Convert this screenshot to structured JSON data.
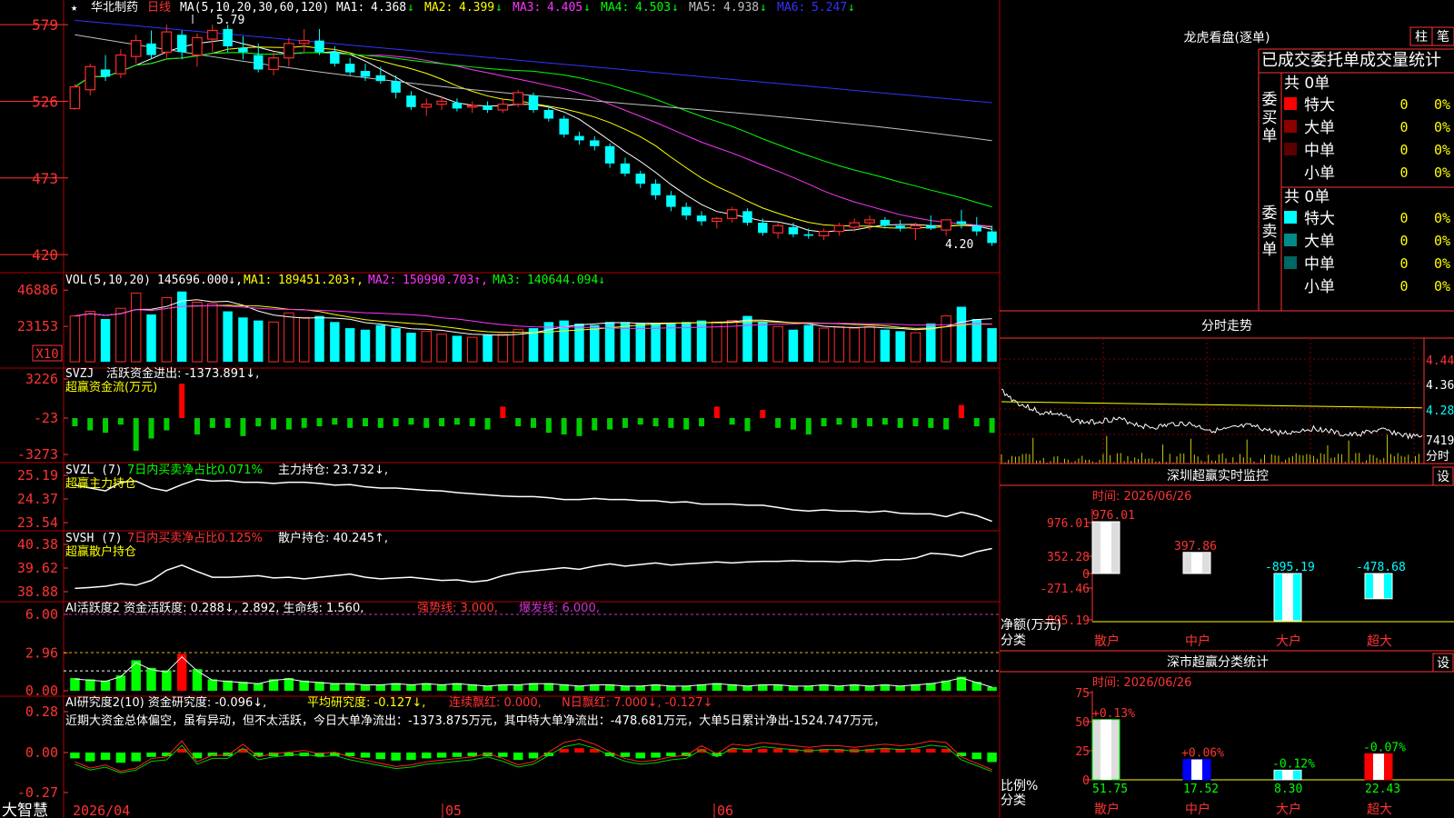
{
  "app": {
    "brand": "大智慧",
    "date_label": "2026/04",
    "month_labels": [
      "05",
      "06"
    ]
  },
  "colors": {
    "up": "#ff2a2a",
    "down": "#00ffff",
    "ma1": "#ffffff",
    "ma2": "#ffff00",
    "ma3": "#ff33ff",
    "ma4": "#00ff00",
    "ma5": "#c0c0c0",
    "ma6": "#3333ff",
    "grid": "#b00000",
    "axis": "#ff3333"
  },
  "price_panel": {
    "stock_name": "华北制药",
    "period": "日线",
    "indicator": "MA(5,10,20,30,60,120)",
    "ma": [
      {
        "label": "MA1:",
        "value": "4.368",
        "dir": "↓"
      },
      {
        "label": "MA2:",
        "value": "4.399",
        "dir": "↓"
      },
      {
        "label": "MA3:",
        "value": "4.405",
        "dir": "↓"
      },
      {
        "label": "MA4:",
        "value": "4.503",
        "dir": "↓"
      },
      {
        "label": "MA5:",
        "value": "4.938",
        "dir": "↓"
      },
      {
        "label": "MA6:",
        "value": "5.247",
        "dir": "↓"
      }
    ],
    "y_ticks": [
      "579",
      "526",
      "473",
      "420"
    ],
    "high_mark": "5.79",
    "low_mark": "4.20"
  },
  "vol_panel": {
    "indicator": "VOL(5,10,20)",
    "value": "145696.000↓,",
    "ma": [
      {
        "label": "MA1:",
        "value": "189451.203↑,"
      },
      {
        "label": "MA2:",
        "value": "150990.703↑,"
      },
      {
        "label": "MA3:",
        "value": "140644.094↓"
      }
    ],
    "y_ticks": [
      "46886",
      "23153"
    ],
    "unit": "X10"
  },
  "svzj_panel": {
    "name": "SVZJ",
    "text": "活跃资金进出: -1373.891↓,",
    "sub": "超赢资金流(万元)",
    "y_ticks": [
      "3226",
      "-23",
      "-3273"
    ]
  },
  "svzl_panel": {
    "name": "SVZL (7)",
    "text1": "7日内买卖净占比0.071%",
    "text2": "主力持仓: 23.732↓,",
    "sub": "超赢主力持仓",
    "y_ticks": [
      "25.19",
      "24.37",
      "23.54"
    ]
  },
  "svsh_panel": {
    "name": "SVSH (7)",
    "text1": "7日内买卖净占比0.125%",
    "text2": "散户持仓: 40.245↑,",
    "sub": "超赢散户持仓",
    "y_ticks": [
      "40.38",
      "39.62",
      "38.88"
    ]
  },
  "ai_panel": {
    "title": "AI活跃度2 资金活跃度: 0.288↓, 2.892, 生命线: 1.560,",
    "strong": "强势线: 3.000,",
    "burst": "爆发线: 6.000,",
    "y_ticks": [
      "6.00",
      "2.96",
      "0.00"
    ]
  },
  "ai2_panel": {
    "title": "AI研究度2(10) 资金研究度: -0.096↓,",
    "avg": "平均研究度: -0.127↓,",
    "red": "连续飘红: 0.000,",
    "nred": "N日飘红: 7.000↓, -0.127↓",
    "comment": "近期大资金总体偏空，虽有异动，但不太活跃，今日大单净流出：-1373.875万元，其中特大单净流出：-478.681万元，大单5日累计净出-1524.747万元，",
    "y_ticks": [
      "0.28",
      "0.00",
      "-0.27"
    ]
  },
  "right": {
    "title": "龙虎看盘(逐单)",
    "btn1": "柱",
    "btn2": "笔",
    "heading": "已成交委托单成交量统计",
    "buy_label": "委买单",
    "sell_label": "委卖单",
    "buy_total": "共 0单",
    "sell_total": "共 0单",
    "buy_rows": [
      {
        "name": "特大",
        "n": "0",
        "p": "0%",
        "c": "#ff0000"
      },
      {
        "name": "大单",
        "n": "0",
        "p": "0%",
        "c": "#8b0000"
      },
      {
        "name": "中单",
        "n": "0",
        "p": "0%",
        "c": "#5a0000"
      },
      {
        "name": "小单",
        "n": "0",
        "p": "0%",
        "c": "#000000"
      }
    ],
    "sell_rows": [
      {
        "name": "特大",
        "n": "0",
        "p": "0%",
        "c": "#00ffff"
      },
      {
        "name": "大单",
        "n": "0",
        "p": "0%",
        "c": "#008b8b"
      },
      {
        "name": "中单",
        "n": "0",
        "p": "0%",
        "c": "#006666"
      },
      {
        "name": "小单",
        "n": "0",
        "p": "0%",
        "c": "#000000"
      }
    ],
    "intraday_title": "分时走势",
    "intraday_ticks": [
      "4.440",
      "4.360",
      "4.280",
      "7419",
      "分时"
    ],
    "monitor_title": "深圳超赢实时监控",
    "monitor_time": "时间: 2026/06/26",
    "set": "设",
    "monitor_axis": [
      "976.01",
      "352.28",
      "0",
      "-271.46",
      "-895.19"
    ],
    "monitor_unit": "净额(万元)",
    "monitor_cat": "分类",
    "monitor_bars": [
      {
        "cat": "散户",
        "value": 976.01,
        "label": "976.01"
      },
      {
        "cat": "中户",
        "value": 397.86,
        "label": "397.86"
      },
      {
        "cat": "大户",
        "value": -895.19,
        "label": "-895.19"
      },
      {
        "cat": "超大",
        "value": -478.68,
        "label": "-478.68"
      }
    ],
    "stat_title": "深市超赢分类统计",
    "stat_time": "时间: 2026/06/26",
    "stat_axis": [
      "75",
      "50",
      "25",
      "0"
    ],
    "stat_unit": "比例%",
    "stat_cat": "分类",
    "stat_bars": [
      {
        "cat": "散户",
        "value": 51.75,
        "label": "51.75",
        "chg": "+0.13%"
      },
      {
        "cat": "中户",
        "value": 17.52,
        "label": "17.52",
        "chg": "+0.06%"
      },
      {
        "cat": "大户",
        "value": 8.3,
        "label": "8.30",
        "chg": "-0.12%"
      },
      {
        "cat": "超大",
        "value": 22.43,
        "label": "22.43",
        "chg": "-0.07%"
      }
    ]
  },
  "chart_data": {
    "type": "candlestick",
    "x": [
      "2026/04",
      "05",
      "06"
    ],
    "ohlc": [
      [
        5.21,
        5.38,
        5.2,
        5.36
      ],
      [
        5.34,
        5.52,
        5.3,
        5.5
      ],
      [
        5.48,
        5.58,
        5.4,
        5.43
      ],
      [
        5.45,
        5.62,
        5.42,
        5.58
      ],
      [
        5.57,
        5.72,
        5.52,
        5.68
      ],
      [
        5.66,
        5.75,
        5.55,
        5.58
      ],
      [
        5.6,
        5.79,
        5.56,
        5.74
      ],
      [
        5.72,
        5.75,
        5.55,
        5.6
      ],
      [
        5.58,
        5.73,
        5.5,
        5.7
      ],
      [
        5.69,
        5.79,
        5.6,
        5.75
      ],
      [
        5.76,
        5.79,
        5.6,
        5.64
      ],
      [
        5.63,
        5.71,
        5.55,
        5.6
      ],
      [
        5.58,
        5.66,
        5.46,
        5.48
      ],
      [
        5.48,
        5.6,
        5.44,
        5.56
      ],
      [
        5.56,
        5.7,
        5.5,
        5.66
      ],
      [
        5.66,
        5.76,
        5.6,
        5.68
      ],
      [
        5.68,
        5.76,
        5.58,
        5.6
      ],
      [
        5.6,
        5.64,
        5.5,
        5.52
      ],
      [
        5.52,
        5.56,
        5.44,
        5.46
      ],
      [
        5.47,
        5.52,
        5.4,
        5.43
      ],
      [
        5.44,
        5.5,
        5.38,
        5.4
      ],
      [
        5.4,
        5.44,
        5.28,
        5.32
      ],
      [
        5.3,
        5.33,
        5.2,
        5.22
      ],
      [
        5.22,
        5.28,
        5.16,
        5.24
      ],
      [
        5.24,
        5.3,
        5.2,
        5.26
      ],
      [
        5.25,
        5.28,
        5.19,
        5.21
      ],
      [
        5.22,
        5.26,
        5.18,
        5.23
      ],
      [
        5.23,
        5.26,
        5.18,
        5.2
      ],
      [
        5.2,
        5.27,
        5.18,
        5.24
      ],
      [
        5.24,
        5.34,
        5.22,
        5.32
      ],
      [
        5.3,
        5.32,
        5.18,
        5.2
      ],
      [
        5.2,
        5.23,
        5.12,
        5.14
      ],
      [
        5.14,
        5.16,
        5.01,
        5.03
      ],
      [
        5.02,
        5.05,
        4.96,
        4.99
      ],
      [
        4.99,
        5.02,
        4.92,
        4.95
      ],
      [
        4.95,
        4.97,
        4.8,
        4.83
      ],
      [
        4.83,
        4.87,
        4.74,
        4.76
      ],
      [
        4.76,
        4.78,
        4.66,
        4.69
      ],
      [
        4.69,
        4.72,
        4.58,
        4.61
      ],
      [
        4.61,
        4.64,
        4.5,
        4.53
      ],
      [
        4.53,
        4.56,
        4.44,
        4.47
      ],
      [
        4.47,
        4.5,
        4.4,
        4.43
      ],
      [
        4.43,
        4.46,
        4.38,
        4.45
      ],
      [
        4.45,
        4.53,
        4.42,
        4.51
      ],
      [
        4.5,
        4.52,
        4.4,
        4.42
      ],
      [
        4.42,
        4.45,
        4.33,
        4.35
      ],
      [
        4.35,
        4.42,
        4.31,
        4.4
      ],
      [
        4.39,
        4.42,
        4.32,
        4.34
      ],
      [
        4.34,
        4.38,
        4.31,
        4.33
      ],
      [
        4.33,
        4.38,
        4.3,
        4.36
      ],
      [
        4.36,
        4.42,
        4.33,
        4.4
      ],
      [
        4.39,
        4.45,
        4.36,
        4.42
      ],
      [
        4.42,
        4.47,
        4.37,
        4.44
      ],
      [
        4.44,
        4.46,
        4.38,
        4.4
      ],
      [
        4.4,
        4.44,
        4.36,
        4.38
      ],
      [
        4.38,
        4.42,
        4.3,
        4.4
      ],
      [
        4.4,
        4.47,
        4.37,
        4.38
      ],
      [
        4.37,
        4.43,
        4.33,
        4.44
      ],
      [
        4.43,
        4.51,
        4.38,
        4.41
      ],
      [
        4.4,
        4.46,
        4.33,
        4.36
      ],
      [
        4.36,
        4.4,
        4.26,
        4.28
      ]
    ],
    "volume": [
      30000,
      33000,
      28000,
      35000,
      45000,
      31000,
      42000,
      46000,
      39000,
      38000,
      33000,
      29000,
      27000,
      26000,
      32000,
      29000,
      30000,
      26000,
      22000,
      21000,
      24000,
      22000,
      19000,
      20000,
      18000,
      17000,
      16000,
      17500,
      18000,
      21000,
      22000,
      26000,
      27000,
      25000,
      24000,
      26000,
      26000,
      25000,
      25000,
      25000,
      26000,
      27000,
      26000,
      27000,
      30000,
      26000,
      23000,
      21000,
      24000,
      22000,
      23000,
      22000,
      23000,
      21000,
      20000,
      19000,
      25000,
      30000,
      36000,
      28000,
      22000
    ],
    "svzj": [
      -10,
      -15,
      -18,
      -8,
      -40,
      -25,
      -15,
      42,
      -20,
      -12,
      -12,
      -22,
      -10,
      -14,
      -14,
      -12,
      -10,
      -8,
      -12,
      -10,
      -12,
      -10,
      -8,
      -12,
      -10,
      -8,
      -10,
      -14,
      14,
      -10,
      -12,
      -18,
      -20,
      -22,
      -15,
      -14,
      -12,
      -8,
      -10,
      -12,
      -14,
      -10,
      14,
      -8,
      -16,
      10,
      -12,
      -14,
      -20,
      -10,
      -8,
      -12,
      -10,
      -8,
      -12,
      -10,
      -12,
      -14,
      16,
      -10,
      -18
    ],
    "svzl": [
      25.05,
      25.0,
      24.95,
      25.1,
      25.12,
      25.0,
      24.95,
      25.06,
      25.15,
      25.12,
      25.13,
      25.1,
      25.1,
      25.08,
      25.1,
      25.1,
      25.08,
      25.05,
      25.06,
      25.02,
      25.0,
      25.0,
      24.98,
      24.96,
      24.95,
      24.92,
      24.9,
      24.88,
      24.86,
      24.85,
      24.85,
      24.83,
      24.8,
      24.8,
      24.82,
      24.8,
      24.8,
      24.78,
      24.78,
      24.75,
      24.76,
      24.72,
      24.72,
      24.72,
      24.7,
      24.7,
      24.66,
      24.62,
      24.6,
      24.62,
      24.6,
      24.6,
      24.58,
      24.6,
      24.56,
      24.55,
      24.55,
      24.5,
      24.58,
      24.52,
      24.42
    ],
    "svsh": [
      38.95,
      38.98,
      39.02,
      39.1,
      39.05,
      39.2,
      39.52,
      39.68,
      39.48,
      39.3,
      39.3,
      39.32,
      39.35,
      39.28,
      39.3,
      39.25,
      39.3,
      39.35,
      39.4,
      39.3,
      39.25,
      39.28,
      39.3,
      39.25,
      39.2,
      39.22,
      39.15,
      39.2,
      39.35,
      39.45,
      39.5,
      39.55,
      39.6,
      39.55,
      39.65,
      39.72,
      39.65,
      39.7,
      39.75,
      39.68,
      39.72,
      39.75,
      39.78,
      39.75,
      39.78,
      39.8,
      39.8,
      39.82,
      39.8,
      39.8,
      39.78,
      39.82,
      39.8,
      39.85,
      39.85,
      39.9,
      40.05,
      40.02,
      39.95,
      40.1,
      40.2
    ],
    "ai": [
      1.0,
      0.9,
      0.8,
      1.2,
      2.4,
      1.8,
      1.6,
      2.9,
      1.7,
      0.9,
      0.8,
      0.7,
      0.6,
      0.9,
      1.0,
      0.8,
      0.7,
      0.6,
      0.6,
      0.5,
      0.5,
      0.6,
      0.5,
      0.6,
      0.5,
      0.6,
      0.5,
      0.4,
      0.5,
      0.5,
      0.6,
      0.6,
      0.5,
      0.4,
      0.5,
      0.5,
      0.4,
      0.4,
      0.5,
      0.4,
      0.4,
      0.5,
      0.6,
      0.5,
      0.4,
      0.5,
      0.5,
      0.4,
      0.4,
      0.5,
      0.4,
      0.5,
      0.4,
      0.5,
      0.4,
      0.5,
      0.6,
      0.8,
      1.1,
      0.7,
      0.3
    ],
    "ai2": [
      -0.08,
      -0.12,
      -0.1,
      -0.14,
      -0.12,
      -0.06,
      -0.05,
      0.05,
      -0.08,
      -0.04,
      -0.04,
      0.03,
      -0.05,
      -0.03,
      -0.02,
      -0.01,
      -0.03,
      -0.02,
      -0.05,
      -0.07,
      -0.09,
      -0.11,
      -0.1,
      -0.08,
      -0.07,
      -0.06,
      -0.05,
      -0.03,
      -0.06,
      -0.1,
      -0.08,
      -0.02,
      0.04,
      0.06,
      0.03,
      -0.02,
      -0.06,
      -0.08,
      -0.07,
      -0.05,
      -0.04,
      0.02,
      -0.03,
      0.03,
      0.02,
      0.04,
      0.03,
      0.02,
      0.01,
      0.02,
      0.02,
      0.01,
      0.02,
      0.03,
      0.02,
      0.03,
      0.05,
      0.04,
      -0.05,
      -0.09,
      -0.13
    ]
  }
}
